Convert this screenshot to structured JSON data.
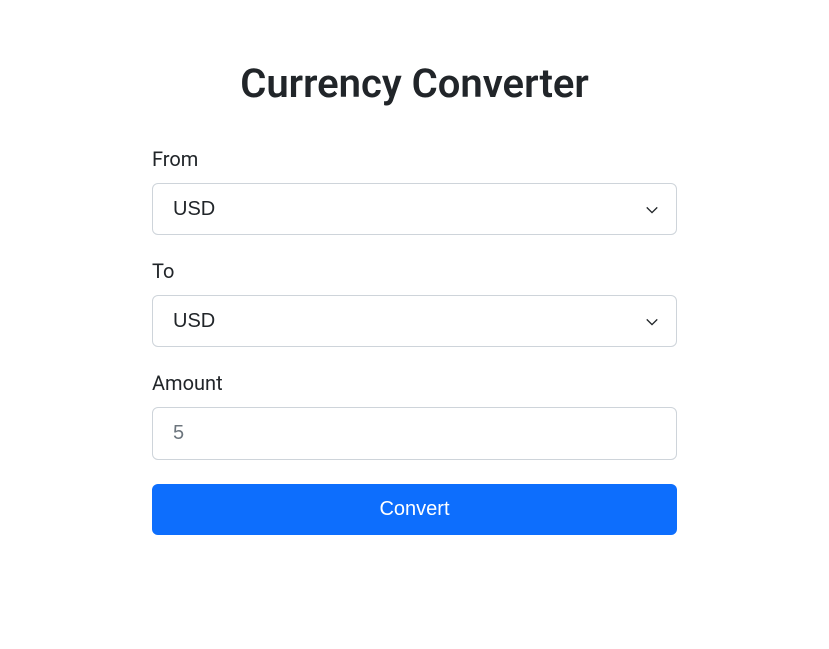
{
  "title": "Currency Converter",
  "form": {
    "from": {
      "label": "From",
      "selected": "USD"
    },
    "to": {
      "label": "To",
      "selected": "USD"
    },
    "amount": {
      "label": "Amount",
      "placeholder": "5",
      "value": ""
    },
    "submit_label": "Convert"
  }
}
